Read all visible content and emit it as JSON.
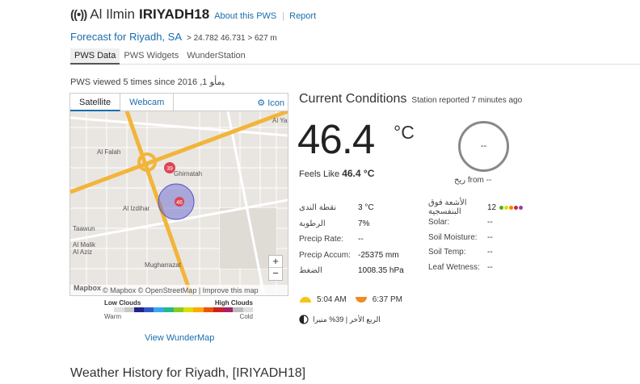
{
  "header": {
    "signal_icon": "broadcast-icon",
    "title_prefix": "Al Ilmin",
    "station_id": "IRIYADH18",
    "about_link": "About this PWS",
    "separator": "|",
    "report_link": "Report"
  },
  "subheader": {
    "forecast_link": "Forecast for Riyadh, SA",
    "coords": "> 24.782 46.731 > 627 m"
  },
  "tabs": [
    {
      "label": "PWS Data"
    },
    {
      "label": "PWS Widgets"
    },
    {
      "label": "WunderStation"
    }
  ],
  "viewed": "PWS viewed 5 times since ﻴﻣﺄﻮ 1, 2016",
  "map": {
    "tabs": [
      "Satellite",
      "Webcam"
    ],
    "icon_toggle": "⚙ Icon",
    "labels": {
      "al_falah": "Al Falah",
      "ghirnatah": "Ghirnatah",
      "al_izdihar": "Al Izdihar",
      "tawun": "Taawun",
      "al_malik": "Al Malik\nAl Aziz",
      "mugharrazat": "Mugharrazat",
      "al_yarmuk": "Al Yar"
    },
    "marker1": "39",
    "marker2": "46",
    "zoom_in": "+",
    "zoom_out": "−",
    "attribution": "© Mapbox © OpenStreetMap | Improve this map",
    "logo": "Mapbox"
  },
  "cloud_legend": {
    "low": "Low Clouds",
    "high": "High Clouds",
    "warm": "Warm",
    "cold": "Cold",
    "colors": [
      "#ffffff",
      "#e0e0e0",
      "#c8c8c8",
      "#222288",
      "#3355cc",
      "#33aaee",
      "#22bb88",
      "#88cc22",
      "#dddd00",
      "#ffaa00",
      "#ee5500",
      "#cc2222",
      "#aa2266",
      "#bbbbbb",
      "#dddddd"
    ]
  },
  "view_wundermap": "View WunderMap",
  "current": {
    "title": "Current Conditions",
    "reported": "Station reported 7 minutes ago",
    "temp": "46.4",
    "temp_unit": "°C",
    "feels_label": "Feels Like",
    "feels_value": "46.4 °C",
    "compass_value": "--",
    "wind_from": "ريح from --"
  },
  "left_metrics": [
    {
      "label": "نقطة الندى",
      "value": "3 °C"
    },
    {
      "label": "الرطوبة",
      "value": "7%"
    },
    {
      "label": "Precip Rate:",
      "value": "--"
    },
    {
      "label": "Precip Accum:",
      "value": "-25375 mm"
    },
    {
      "label": "الضغط",
      "value": "1008.35 hPa"
    }
  ],
  "right_metrics": [
    {
      "label": "الأشعة فوق البنفسجية",
      "value": "12"
    },
    {
      "label": "Solar:",
      "value": "--"
    },
    {
      "label": "Soil Moisture:",
      "value": "--"
    },
    {
      "label": "Soil Temp:",
      "value": "--"
    },
    {
      "label": "Leaf Wetness:",
      "value": "--"
    }
  ],
  "uv_colors": [
    "#55aa22",
    "#dddd00",
    "#ee8800",
    "#dd2222",
    "#8844aa"
  ],
  "sun": {
    "sunrise": "5:04 AM",
    "sunset": "6:37 PM"
  },
  "moon": {
    "text": "الربع الأخر | 39% منيرا"
  },
  "history_title": "Weather History for Riyadh, [IRIYADH18]"
}
